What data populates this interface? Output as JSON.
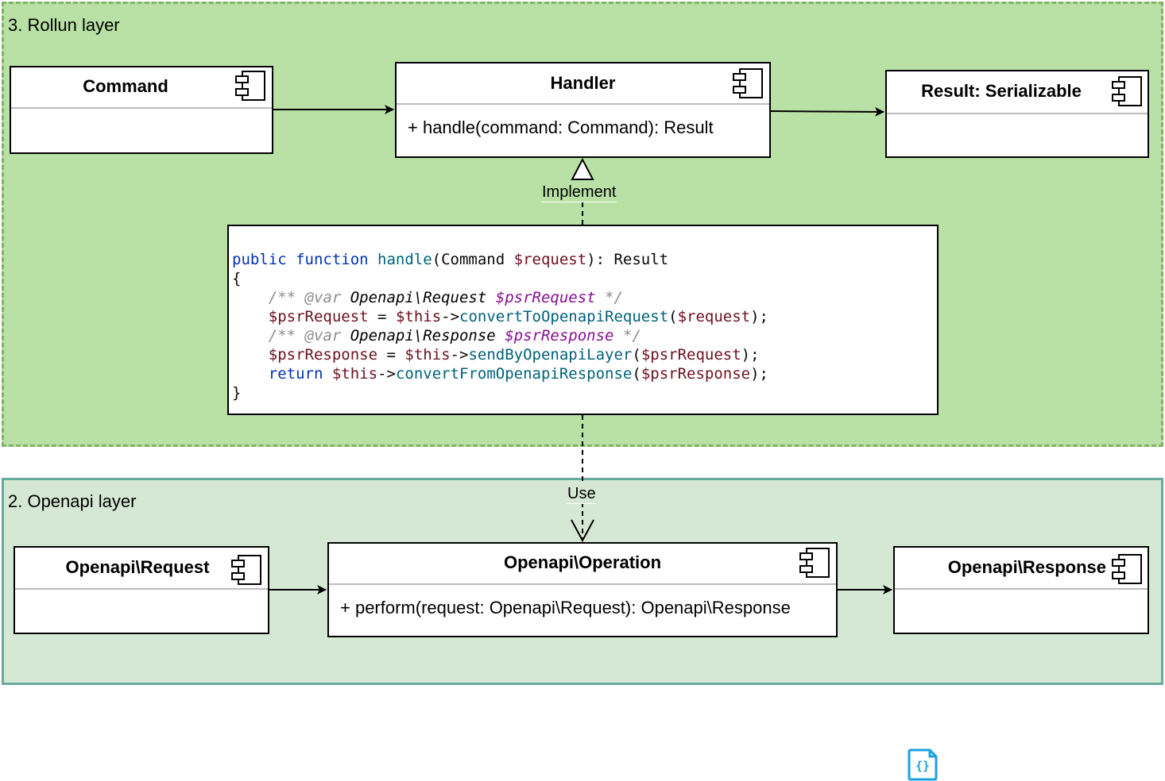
{
  "rollun_layer": {
    "title": "3. Rollun layer",
    "command": {
      "title": "Command"
    },
    "handler": {
      "title": "Handler",
      "method": "+ handle(command: Command): Result"
    },
    "result": {
      "title": "Result: Serializable"
    },
    "implement_label": "Implement",
    "code": {
      "lines": [
        [
          {
            "t": "public function ",
            "c": "kw"
          },
          {
            "t": "handle",
            "c": "fn"
          },
          {
            "t": "(Command ",
            "c": ""
          },
          {
            "t": "$request",
            "c": "v"
          },
          {
            "t": "): Result",
            "c": ""
          }
        ],
        [
          {
            "t": "{",
            "c": ""
          }
        ],
        [
          {
            "t": "    /** @var ",
            "c": "cm"
          },
          {
            "t": "Openapi\\Request ",
            "c": "cm-type"
          },
          {
            "t": "$psrRequest",
            "c": "cm-var"
          },
          {
            "t": " */",
            "c": "cm"
          }
        ],
        [
          {
            "t": "    ",
            "c": ""
          },
          {
            "t": "$psrRequest",
            "c": "v"
          },
          {
            "t": " = ",
            "c": ""
          },
          {
            "t": "$this",
            "c": "v"
          },
          {
            "t": "->",
            "c": ""
          },
          {
            "t": "convertToOpenapiRequest",
            "c": "fn"
          },
          {
            "t": "(",
            "c": ""
          },
          {
            "t": "$request",
            "c": "v"
          },
          {
            "t": ");",
            "c": ""
          }
        ],
        [
          {
            "t": "    /** @var ",
            "c": "cm"
          },
          {
            "t": "Openapi\\Response ",
            "c": "cm-type"
          },
          {
            "t": "$psrResponse",
            "c": "cm-var"
          },
          {
            "t": " */",
            "c": "cm"
          }
        ],
        [
          {
            "t": "    ",
            "c": ""
          },
          {
            "t": "$psrResponse",
            "c": "v"
          },
          {
            "t": " = ",
            "c": ""
          },
          {
            "t": "$this",
            "c": "v"
          },
          {
            "t": "->",
            "c": ""
          },
          {
            "t": "sendByOpenapiLayer",
            "c": "fn"
          },
          {
            "t": "(",
            "c": ""
          },
          {
            "t": "$psrRequest",
            "c": "v"
          },
          {
            "t": ");",
            "c": ""
          }
        ],
        [
          {
            "t": "    ",
            "c": ""
          },
          {
            "t": "return ",
            "c": "kw"
          },
          {
            "t": "$this",
            "c": "v"
          },
          {
            "t": "->",
            "c": ""
          },
          {
            "t": "convertFromOpenapiResponse",
            "c": "fn"
          },
          {
            "t": "(",
            "c": ""
          },
          {
            "t": "$psrResponse",
            "c": "v"
          },
          {
            "t": ");",
            "c": ""
          }
        ],
        [
          {
            "t": "}",
            "c": ""
          }
        ]
      ]
    }
  },
  "openapi_layer": {
    "title": "2. Openapi layer",
    "request": {
      "title": "Openapi\\Request"
    },
    "operation": {
      "title": "Openapi\\Operation",
      "method": "+ perform(request: Openapi\\Request): Openapi\\Response"
    },
    "response": {
      "title": "Openapi\\Response"
    },
    "use_label": "Use"
  },
  "colors": {
    "rollun_fill": "#b9e0a5",
    "rollun_border": "#82b366",
    "openapi_fill": "#d5e8d4",
    "openapi_border": "#67ab9f",
    "json_icon": "#1ba1e2"
  },
  "icons": [
    "component-icon",
    "json-file-icon"
  ]
}
